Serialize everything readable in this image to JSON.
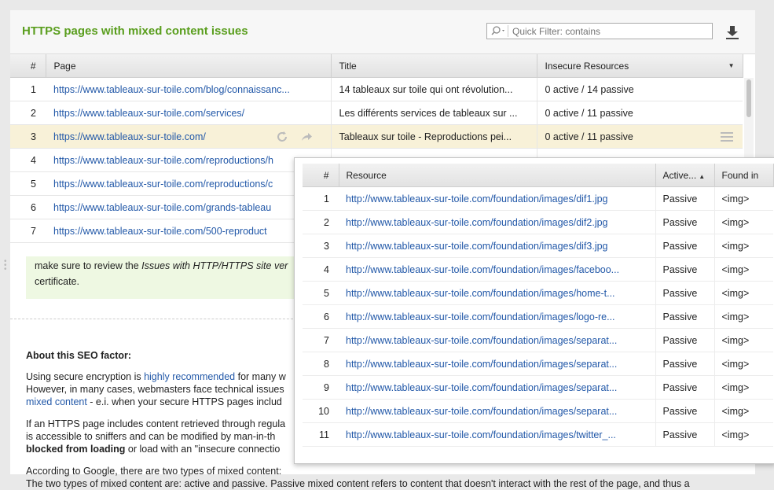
{
  "header": {
    "title": "HTTPS pages with mixed content issues",
    "filter_placeholder": "Quick Filter: contains"
  },
  "main_table": {
    "columns": {
      "num": "#",
      "page": "Page",
      "title": "Title",
      "resources": "Insecure Resources"
    },
    "rows": [
      {
        "num": "1",
        "page": "https://www.tableaux-sur-toile.com/blog/connaissanc...",
        "title": "14 tableaux sur toile qui ont révolution...",
        "res": "0 active / 14 passive"
      },
      {
        "num": "2",
        "page": "https://www.tableaux-sur-toile.com/services/",
        "title": "Les différents services de tableaux sur ...",
        "res": "0 active / 11 passive"
      },
      {
        "num": "3",
        "page": "https://www.tableaux-sur-toile.com/",
        "title": "Tableaux sur toile - Reproductions pei...",
        "res": "0 active / 11 passive"
      },
      {
        "num": "4",
        "page": "https://www.tableaux-sur-toile.com/reproductions/h",
        "title": "",
        "res": ""
      },
      {
        "num": "5",
        "page": "https://www.tableaux-sur-toile.com/reproductions/c",
        "title": "",
        "res": ""
      },
      {
        "num": "6",
        "page": "https://www.tableaux-sur-toile.com/grands-tableau",
        "title": "",
        "res": ""
      },
      {
        "num": "7",
        "page": "https://www.tableaux-sur-toile.com/500-reproduct",
        "title": "",
        "res": ""
      }
    ]
  },
  "description": {
    "notice_line1_prefix": "make sure to review the ",
    "notice_line1_italic": "Issues with HTTP/HTTPS site ver",
    "notice_line2": "certificate.",
    "about_heading": "About this SEO factor:",
    "p1_a": "Using secure encryption is ",
    "p1_link": "highly recommended",
    "p1_b": " for many w",
    "p1_line2": "However, in many cases, webmasters face technical issues",
    "p1_link2": "mixed content",
    "p1_line3": " - e.i. when your secure HTTPS pages includ",
    "p2_line1": "If an HTTPS page includes content retrieved through regula",
    "p2_line2": "is accessible to sniffers and can be modified by man-in-th",
    "p2_bold": "blocked from loading",
    "p2_line3": " or load with an \"insecure connectio",
    "p3_line1": "According to Google, there are two types of mixed content:",
    "p3_line2": "The two types of mixed content are: active and passive. Passive mixed content refers to content that doesn't interact with the rest of the page, and thus a"
  },
  "popup": {
    "columns": {
      "num": "#",
      "resource": "Resource",
      "type": "Active...",
      "found": "Found in"
    },
    "rows": [
      {
        "num": "1",
        "url": "http://www.tableaux-sur-toile.com/foundation/images/dif1.jpg",
        "type": "Passive",
        "found": "<img>"
      },
      {
        "num": "2",
        "url": "http://www.tableaux-sur-toile.com/foundation/images/dif2.jpg",
        "type": "Passive",
        "found": "<img>"
      },
      {
        "num": "3",
        "url": "http://www.tableaux-sur-toile.com/foundation/images/dif3.jpg",
        "type": "Passive",
        "found": "<img>"
      },
      {
        "num": "4",
        "url": "http://www.tableaux-sur-toile.com/foundation/images/faceboo...",
        "type": "Passive",
        "found": "<img>"
      },
      {
        "num": "5",
        "url": "http://www.tableaux-sur-toile.com/foundation/images/home-t...",
        "type": "Passive",
        "found": "<img>"
      },
      {
        "num": "6",
        "url": "http://www.tableaux-sur-toile.com/foundation/images/logo-re...",
        "type": "Passive",
        "found": "<img>"
      },
      {
        "num": "7",
        "url": "http://www.tableaux-sur-toile.com/foundation/images/separat...",
        "type": "Passive",
        "found": "<img>"
      },
      {
        "num": "8",
        "url": "http://www.tableaux-sur-toile.com/foundation/images/separat...",
        "type": "Passive",
        "found": "<img>"
      },
      {
        "num": "9",
        "url": "http://www.tableaux-sur-toile.com/foundation/images/separat...",
        "type": "Passive",
        "found": "<img>"
      },
      {
        "num": "10",
        "url": "http://www.tableaux-sur-toile.com/foundation/images/separat...",
        "type": "Passive",
        "found": "<img>"
      },
      {
        "num": "11",
        "url": "http://www.tableaux-sur-toile.com/foundation/images/twitter_...",
        "type": "Passive",
        "found": "<img>"
      }
    ]
  },
  "colors": {
    "accent_green": "#5a9e1e",
    "link_blue": "#2258a8",
    "selected_row": "#f8f1d8"
  },
  "icons": [
    "search-icon",
    "chevron-down-icon",
    "download-icon",
    "refresh-icon",
    "share-arrow-icon",
    "menu-icon",
    "sort-desc-icon",
    "sort-asc-icon"
  ]
}
